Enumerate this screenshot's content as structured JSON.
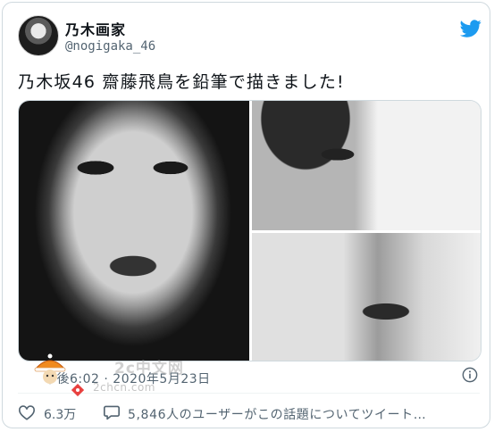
{
  "author": {
    "display_name": "乃木画家",
    "handle": "@nogigaka_46"
  },
  "tweet": {
    "text": "乃木坂46 齋藤飛鳥を鉛筆で描きました!",
    "timestamp": "午後6:02 · 2020年5月23日",
    "like_count": "6.3万",
    "reply_prompt": "5,846人のユーザーがこの話題についてツイート…"
  },
  "watermark": {
    "main": "2c中文网",
    "sub": "2chcn.com"
  },
  "icons": {
    "brand": "twitter-bird-icon",
    "info": "info-icon",
    "like": "heart-icon",
    "reply": "comment-icon"
  },
  "colors": {
    "twitter_blue": "#1d9bf0",
    "secondary_text": "#536471",
    "border": "#cfd9de"
  }
}
